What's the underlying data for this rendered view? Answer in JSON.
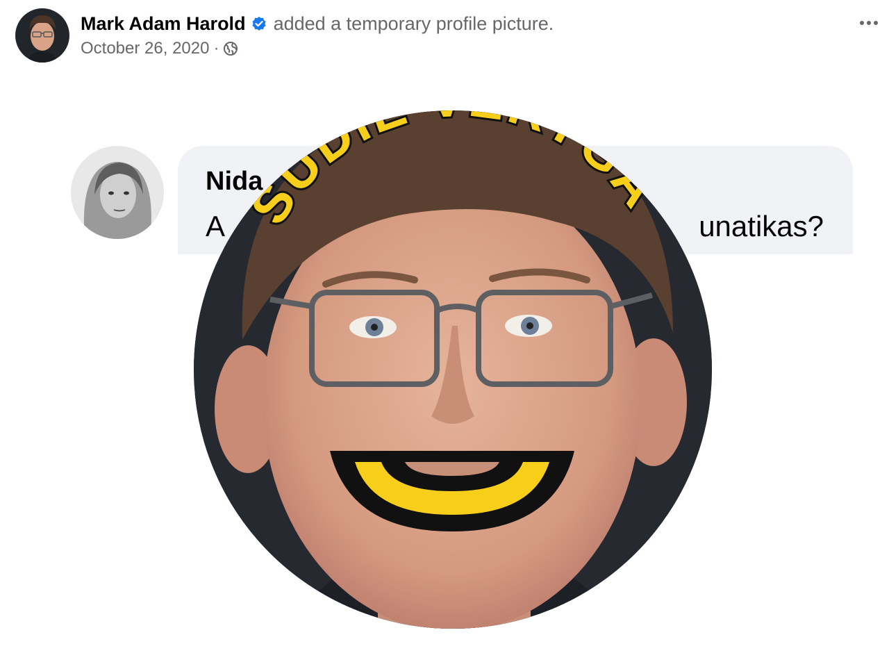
{
  "post": {
    "author": "Mark Adam Harold",
    "action": "added a temporary profile picture.",
    "date": "October 26, 2020",
    "separator": "·",
    "verified_icon": "verified-badge-icon",
    "privacy_icon": "globe-icon",
    "more_icon": "more-options-icon"
  },
  "comment": {
    "author": "Nida",
    "text_start": "A",
    "text_end": "unatikas?"
  },
  "frame": {
    "arc_text": "SUDIE VERYGA",
    "accent": "#f7cf1a",
    "outline": "#111111"
  },
  "colors": {
    "verified_blue": "#1877f2",
    "meta_gray": "#65676b",
    "bubble_bg": "#f0f2f5"
  }
}
